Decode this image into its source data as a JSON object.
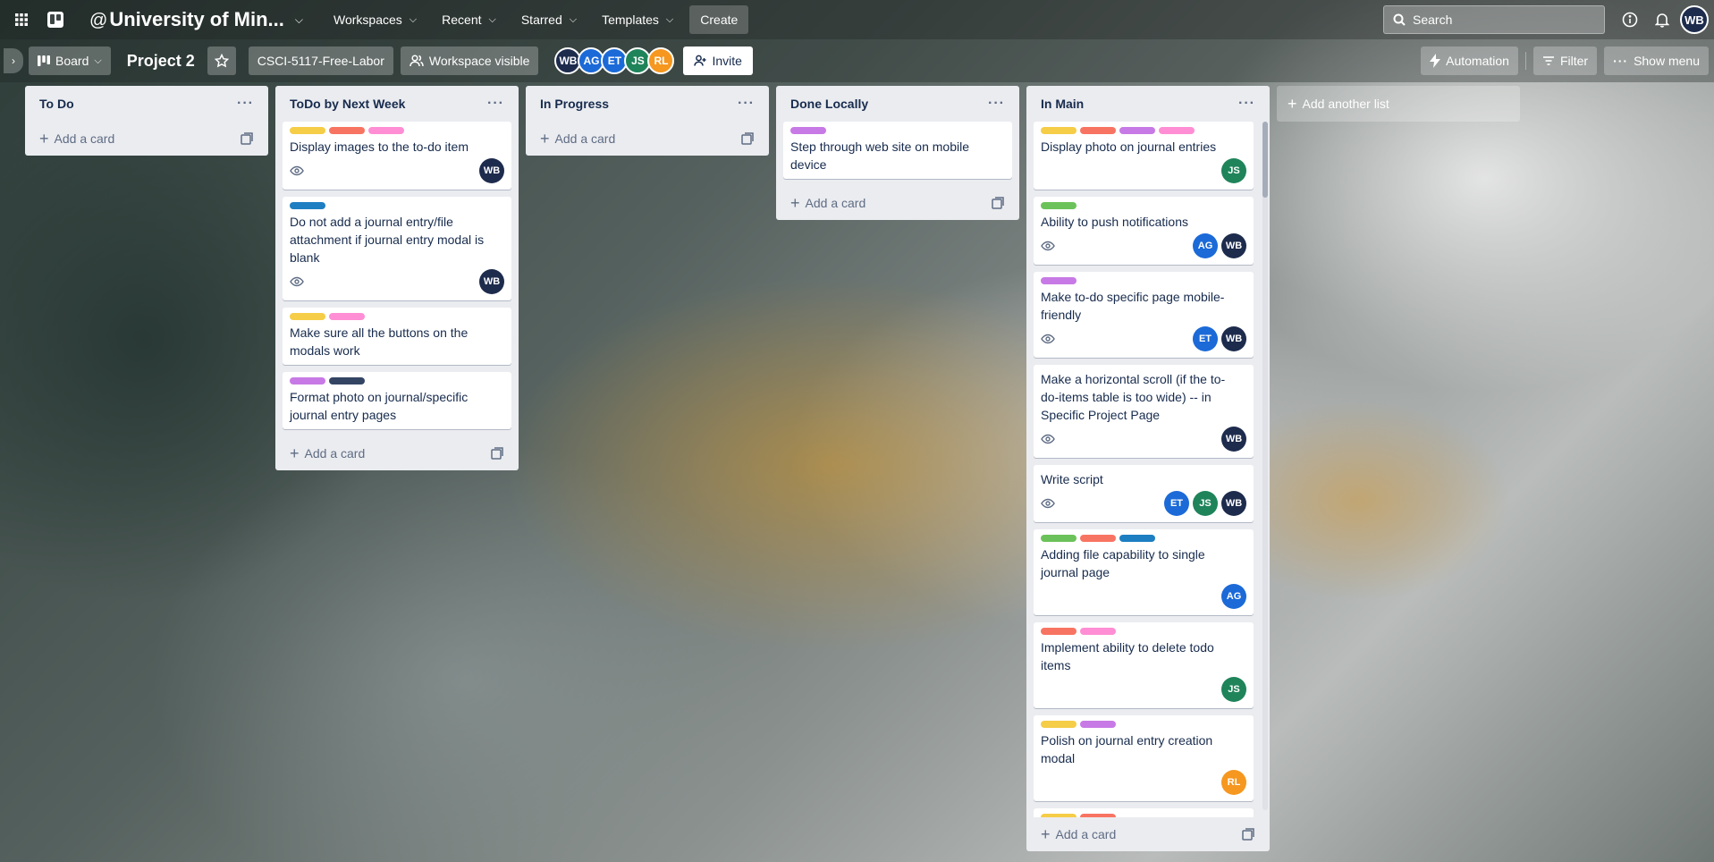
{
  "colors": {
    "yellow": "#f5cd47",
    "red": "#f87462",
    "purple": "#c77ae5",
    "pink": "#ff8ed4",
    "blue": "#1d7ec2",
    "navy": "#344563",
    "green": "#6cc25a",
    "wb": "#1d2b4d",
    "ag": "#1b6ad8",
    "et": "#1b6ad8",
    "js": "#1f845a",
    "rl": "#f6971f"
  },
  "topnav": {
    "apps_icon": "grid-icon",
    "workspace_at": "@",
    "workspace_name": "University of Min...",
    "menu": [
      {
        "label": "Workspaces"
      },
      {
        "label": "Recent"
      },
      {
        "label": "Starred"
      },
      {
        "label": "Templates"
      }
    ],
    "create_label": "Create",
    "search_placeholder": "Search",
    "user_initials": "WB"
  },
  "board": {
    "view_label": "Board",
    "title": "Project 2",
    "workspace_tag": "CSCI-5117-Free-Labor",
    "visibility_label": "Workspace visible",
    "members": [
      "WB",
      "AG",
      "ET",
      "JS",
      "RL"
    ],
    "invite_label": "Invite",
    "automation_label": "Automation",
    "filter_label": "Filter",
    "show_menu_label": "Show menu",
    "add_list_label": "Add another list"
  },
  "lists": [
    {
      "title": "To Do",
      "add_card": "Add a card",
      "cards": []
    },
    {
      "title": "ToDo by Next Week",
      "add_card": "Add a card",
      "cards": [
        {
          "labels": [
            "yellow",
            "red",
            "pink"
          ],
          "title": "Display images to the to-do item",
          "watch": true,
          "members": [
            "WB"
          ]
        },
        {
          "labels": [
            "blue"
          ],
          "title": "Do not add a journal entry/file attachment if journal entry modal is blank",
          "watch": true,
          "members": [
            "WB"
          ]
        },
        {
          "labels": [
            "yellow",
            "pink"
          ],
          "title": "Make sure all the buttons on the modals work",
          "watch": false,
          "members": []
        },
        {
          "labels": [
            "purple",
            "navy"
          ],
          "title": "Format photo on journal/specific journal entry pages",
          "watch": false,
          "members": []
        }
      ]
    },
    {
      "title": "In Progress",
      "add_card": "Add a card",
      "cards": []
    },
    {
      "title": "Done Locally",
      "add_card": "Add a card",
      "cards": [
        {
          "labels": [
            "purple"
          ],
          "title": "Step through web site on mobile device",
          "watch": false,
          "members": []
        }
      ]
    },
    {
      "title": "In Main",
      "add_card": "Add a card",
      "cards": [
        {
          "labels": [
            "yellow",
            "red",
            "purple",
            "pink"
          ],
          "title": "Display photo on journal entries",
          "watch": false,
          "members": [
            "JS"
          ]
        },
        {
          "labels": [
            "green"
          ],
          "title": "Ability to push notifications",
          "watch": true,
          "members": [
            "AG",
            "WB"
          ]
        },
        {
          "labels": [
            "purple"
          ],
          "title": "Make to-do specific page mobile-friendly",
          "watch": true,
          "members": [
            "ET",
            "WB"
          ]
        },
        {
          "labels": [],
          "title": "Make a horizontal scroll (if the to-do-items table is too wide) -- in Specific Project Page",
          "watch": true,
          "members": [
            "WB"
          ]
        },
        {
          "labels": [],
          "title": "Write script",
          "watch": true,
          "members": [
            "ET",
            "JS",
            "WB"
          ]
        },
        {
          "labels": [
            "green",
            "red",
            "blue"
          ],
          "title": "Adding file capability to single journal page",
          "watch": false,
          "members": [
            "AG"
          ]
        },
        {
          "labels": [
            "red",
            "pink"
          ],
          "title": "Implement ability to delete todo items",
          "watch": false,
          "members": [
            "JS"
          ]
        },
        {
          "labels": [
            "yellow",
            "purple"
          ],
          "title": "Polish on journal entry creation modal",
          "watch": false,
          "members": [
            "RL"
          ]
        },
        {
          "labels": [
            "yellow",
            "red"
          ],
          "title": "",
          "watch": false,
          "members": []
        }
      ]
    }
  ]
}
